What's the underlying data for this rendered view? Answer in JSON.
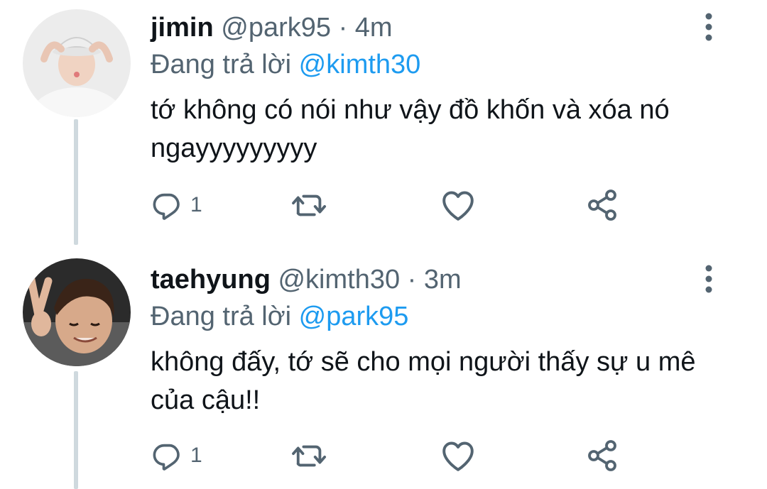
{
  "tweets": [
    {
      "name": "jimin",
      "handle": "@park95",
      "separator": "·",
      "time": "4m",
      "reply_prefix": "Đang trả lời",
      "reply_mention": "@kimth30",
      "text": "tớ không có nói như vậy đồ khốn và xóa nó ngayyyyyyyyy",
      "reply_count": "1",
      "icons": [
        "reply-icon",
        "retweet-icon",
        "like-icon",
        "share-icon",
        "more-icon"
      ]
    },
    {
      "name": "taehyung",
      "handle": "@kimth30",
      "separator": "·",
      "time": "3m",
      "reply_prefix": "Đang trả lời",
      "reply_mention": "@park95",
      "text": "không đấy, tớ sẽ cho mọi người thấy sự u mê của cậu!!",
      "reply_count": "1",
      "icons": [
        "reply-icon",
        "retweet-icon",
        "like-icon",
        "share-icon",
        "more-icon"
      ]
    }
  ],
  "colors": {
    "text_primary": "#0f1419",
    "text_secondary": "#536471",
    "mention": "#1d9bf0",
    "thread_line": "#cfd9de"
  }
}
